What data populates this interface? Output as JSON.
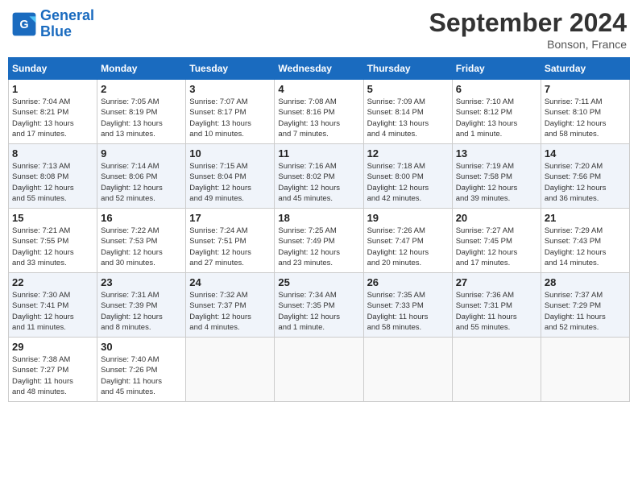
{
  "header": {
    "logo_line1": "General",
    "logo_line2": "Blue",
    "month_title": "September 2024",
    "location": "Bonson, France"
  },
  "weekdays": [
    "Sunday",
    "Monday",
    "Tuesday",
    "Wednesday",
    "Thursday",
    "Friday",
    "Saturday"
  ],
  "weeks": [
    [
      {
        "day": "1",
        "info": "Sunrise: 7:04 AM\nSunset: 8:21 PM\nDaylight: 13 hours\nand 17 minutes."
      },
      {
        "day": "2",
        "info": "Sunrise: 7:05 AM\nSunset: 8:19 PM\nDaylight: 13 hours\nand 13 minutes."
      },
      {
        "day": "3",
        "info": "Sunrise: 7:07 AM\nSunset: 8:17 PM\nDaylight: 13 hours\nand 10 minutes."
      },
      {
        "day": "4",
        "info": "Sunrise: 7:08 AM\nSunset: 8:16 PM\nDaylight: 13 hours\nand 7 minutes."
      },
      {
        "day": "5",
        "info": "Sunrise: 7:09 AM\nSunset: 8:14 PM\nDaylight: 13 hours\nand 4 minutes."
      },
      {
        "day": "6",
        "info": "Sunrise: 7:10 AM\nSunset: 8:12 PM\nDaylight: 13 hours\nand 1 minute."
      },
      {
        "day": "7",
        "info": "Sunrise: 7:11 AM\nSunset: 8:10 PM\nDaylight: 12 hours\nand 58 minutes."
      }
    ],
    [
      {
        "day": "8",
        "info": "Sunrise: 7:13 AM\nSunset: 8:08 PM\nDaylight: 12 hours\nand 55 minutes."
      },
      {
        "day": "9",
        "info": "Sunrise: 7:14 AM\nSunset: 8:06 PM\nDaylight: 12 hours\nand 52 minutes."
      },
      {
        "day": "10",
        "info": "Sunrise: 7:15 AM\nSunset: 8:04 PM\nDaylight: 12 hours\nand 49 minutes."
      },
      {
        "day": "11",
        "info": "Sunrise: 7:16 AM\nSunset: 8:02 PM\nDaylight: 12 hours\nand 45 minutes."
      },
      {
        "day": "12",
        "info": "Sunrise: 7:18 AM\nSunset: 8:00 PM\nDaylight: 12 hours\nand 42 minutes."
      },
      {
        "day": "13",
        "info": "Sunrise: 7:19 AM\nSunset: 7:58 PM\nDaylight: 12 hours\nand 39 minutes."
      },
      {
        "day": "14",
        "info": "Sunrise: 7:20 AM\nSunset: 7:56 PM\nDaylight: 12 hours\nand 36 minutes."
      }
    ],
    [
      {
        "day": "15",
        "info": "Sunrise: 7:21 AM\nSunset: 7:55 PM\nDaylight: 12 hours\nand 33 minutes."
      },
      {
        "day": "16",
        "info": "Sunrise: 7:22 AM\nSunset: 7:53 PM\nDaylight: 12 hours\nand 30 minutes."
      },
      {
        "day": "17",
        "info": "Sunrise: 7:24 AM\nSunset: 7:51 PM\nDaylight: 12 hours\nand 27 minutes."
      },
      {
        "day": "18",
        "info": "Sunrise: 7:25 AM\nSunset: 7:49 PM\nDaylight: 12 hours\nand 23 minutes."
      },
      {
        "day": "19",
        "info": "Sunrise: 7:26 AM\nSunset: 7:47 PM\nDaylight: 12 hours\nand 20 minutes."
      },
      {
        "day": "20",
        "info": "Sunrise: 7:27 AM\nSunset: 7:45 PM\nDaylight: 12 hours\nand 17 minutes."
      },
      {
        "day": "21",
        "info": "Sunrise: 7:29 AM\nSunset: 7:43 PM\nDaylight: 12 hours\nand 14 minutes."
      }
    ],
    [
      {
        "day": "22",
        "info": "Sunrise: 7:30 AM\nSunset: 7:41 PM\nDaylight: 12 hours\nand 11 minutes."
      },
      {
        "day": "23",
        "info": "Sunrise: 7:31 AM\nSunset: 7:39 PM\nDaylight: 12 hours\nand 8 minutes."
      },
      {
        "day": "24",
        "info": "Sunrise: 7:32 AM\nSunset: 7:37 PM\nDaylight: 12 hours\nand 4 minutes."
      },
      {
        "day": "25",
        "info": "Sunrise: 7:34 AM\nSunset: 7:35 PM\nDaylight: 12 hours\nand 1 minute."
      },
      {
        "day": "26",
        "info": "Sunrise: 7:35 AM\nSunset: 7:33 PM\nDaylight: 11 hours\nand 58 minutes."
      },
      {
        "day": "27",
        "info": "Sunrise: 7:36 AM\nSunset: 7:31 PM\nDaylight: 11 hours\nand 55 minutes."
      },
      {
        "day": "28",
        "info": "Sunrise: 7:37 AM\nSunset: 7:29 PM\nDaylight: 11 hours\nand 52 minutes."
      }
    ],
    [
      {
        "day": "29",
        "info": "Sunrise: 7:38 AM\nSunset: 7:27 PM\nDaylight: 11 hours\nand 48 minutes."
      },
      {
        "day": "30",
        "info": "Sunrise: 7:40 AM\nSunset: 7:26 PM\nDaylight: 11 hours\nand 45 minutes."
      },
      {
        "day": "",
        "info": ""
      },
      {
        "day": "",
        "info": ""
      },
      {
        "day": "",
        "info": ""
      },
      {
        "day": "",
        "info": ""
      },
      {
        "day": "",
        "info": ""
      }
    ]
  ]
}
